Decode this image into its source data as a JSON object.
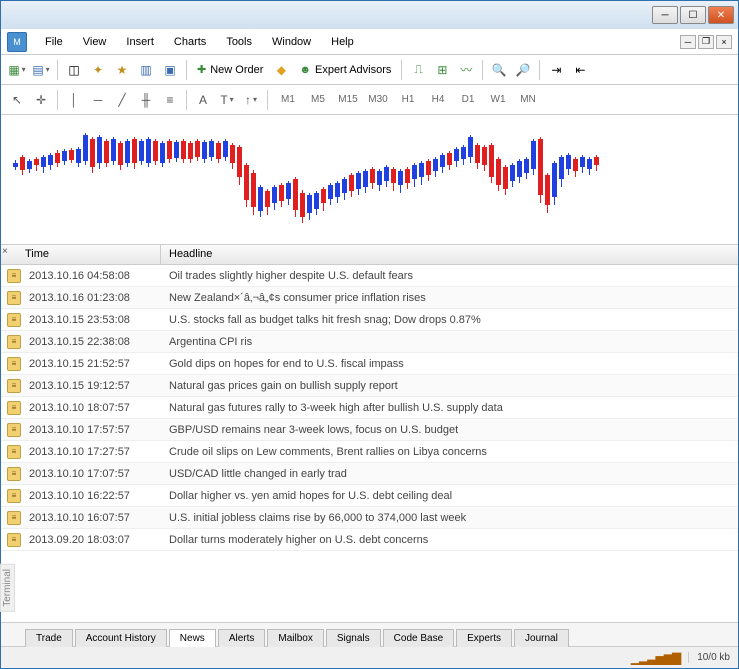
{
  "menu": {
    "items": [
      "File",
      "View",
      "Insert",
      "Charts",
      "Tools",
      "Window",
      "Help"
    ]
  },
  "toolbar": {
    "new_order": "New Order",
    "expert_advisors": "Expert Advisors"
  },
  "timeframes": [
    "M1",
    "M5",
    "M15",
    "M30",
    "H1",
    "H4",
    "D1",
    "W1",
    "MN"
  ],
  "news": {
    "columns": {
      "time": "Time",
      "headline": "Headline"
    },
    "rows": [
      {
        "time": "2013.10.16 04:58:08",
        "headline": "Oil trades slightly higher despite U.S. default fears"
      },
      {
        "time": "2013.10.16 01:23:08",
        "headline": "New Zealand×´â‚¬â„¢s consumer price inflation rises"
      },
      {
        "time": "2013.10.15 23:53:08",
        "headline": "U.S. stocks fall as budget talks hit fresh snag; Dow drops 0.87%"
      },
      {
        "time": "2013.10.15 22:38:08",
        "headline": "Argentina CPI ris"
      },
      {
        "time": "2013.10.15 21:52:57",
        "headline": "Gold dips on hopes for end to U.S. fiscal impass"
      },
      {
        "time": "2013.10.15 19:12:57",
        "headline": "Natural gas prices gain on bullish supply report"
      },
      {
        "time": "2013.10.10 18:07:57",
        "headline": "Natural gas futures rally to 3-week high after bullish U.S. supply data"
      },
      {
        "time": "2013.10.10 17:57:57",
        "headline": "GBP/USD remains near 3-week lows, focus on U.S. budget"
      },
      {
        "time": "2013.10.10 17:27:57",
        "headline": "Crude oil slips on Lew comments, Brent rallies on Libya concerns"
      },
      {
        "time": "2013.10.10 17:07:57",
        "headline": "USD/CAD little changed in early trad"
      },
      {
        "time": "2013.10.10 16:22:57",
        "headline": "Dollar higher vs. yen amid hopes for U.S. debt ceiling deal"
      },
      {
        "time": "2013.10.10 16:07:57",
        "headline": "U.S. initial jobless claims rise by 66,000 to 374,000 last week"
      },
      {
        "time": "2013.09.20 18:03:07",
        "headline": "Dollar turns moderately higher on U.S. debt concerns"
      }
    ]
  },
  "tabs": [
    "Trade",
    "Account History",
    "News",
    "Alerts",
    "Mailbox",
    "Signals",
    "Code Base",
    "Experts",
    "Journal"
  ],
  "active_tab": "News",
  "status": {
    "kb": "10/0 kb"
  },
  "terminal_label": "Terminal",
  "chart_data": {
    "type": "candlestick",
    "note": "Approximate candlestick OHLC sketch as rendered; values are pixel positions not prices",
    "candles": [
      [
        12,
        45,
        55,
        48,
        52,
        "b"
      ],
      [
        19,
        40,
        60,
        42,
        55,
        "r"
      ],
      [
        26,
        44,
        58,
        46,
        54,
        "b"
      ],
      [
        33,
        42,
        56,
        44,
        50,
        "r"
      ],
      [
        40,
        40,
        58,
        42,
        52,
        "b"
      ],
      [
        47,
        38,
        55,
        40,
        50,
        "b"
      ],
      [
        54,
        35,
        52,
        38,
        48,
        "r"
      ],
      [
        61,
        34,
        50,
        36,
        46,
        "b"
      ],
      [
        68,
        33,
        48,
        35,
        45,
        "r"
      ],
      [
        75,
        32,
        52,
        34,
        48,
        "b"
      ],
      [
        82,
        18,
        50,
        20,
        46,
        "b"
      ],
      [
        89,
        22,
        58,
        24,
        52,
        "r"
      ],
      [
        96,
        20,
        54,
        22,
        48,
        "b"
      ],
      [
        103,
        24,
        52,
        26,
        48,
        "r"
      ],
      [
        110,
        22,
        50,
        24,
        46,
        "b"
      ],
      [
        117,
        26,
        55,
        28,
        50,
        "r"
      ],
      [
        124,
        24,
        52,
        26,
        48,
        "b"
      ],
      [
        131,
        22,
        54,
        24,
        48,
        "r"
      ],
      [
        138,
        24,
        50,
        26,
        46,
        "b"
      ],
      [
        145,
        22,
        52,
        24,
        48,
        "b"
      ],
      [
        152,
        24,
        50,
        26,
        46,
        "r"
      ],
      [
        159,
        26,
        52,
        28,
        48,
        "b"
      ],
      [
        166,
        24,
        48,
        26,
        44,
        "r"
      ],
      [
        173,
        25,
        47,
        27,
        43,
        "b"
      ],
      [
        180,
        24,
        48,
        26,
        44,
        "r"
      ],
      [
        187,
        26,
        48,
        28,
        44,
        "r"
      ],
      [
        194,
        24,
        46,
        26,
        42,
        "r"
      ],
      [
        201,
        25,
        48,
        27,
        44,
        "b"
      ],
      [
        208,
        24,
        46,
        26,
        42,
        "b"
      ],
      [
        215,
        26,
        48,
        28,
        44,
        "r"
      ],
      [
        222,
        24,
        46,
        26,
        42,
        "b"
      ],
      [
        229,
        28,
        54,
        30,
        48,
        "r"
      ],
      [
        236,
        30,
        70,
        32,
        62,
        "r"
      ],
      [
        243,
        48,
        92,
        50,
        85,
        "r"
      ],
      [
        250,
        55,
        100,
        58,
        92,
        "r"
      ],
      [
        257,
        70,
        102,
        72,
        96,
        "b"
      ],
      [
        264,
        74,
        100,
        76,
        92,
        "r"
      ],
      [
        271,
        70,
        95,
        72,
        88,
        "b"
      ],
      [
        278,
        68,
        92,
        70,
        86,
        "r"
      ],
      [
        285,
        66,
        90,
        68,
        84,
        "b"
      ],
      [
        292,
        62,
        102,
        64,
        95,
        "r"
      ],
      [
        299,
        75,
        108,
        78,
        102,
        "r"
      ],
      [
        306,
        78,
        105,
        80,
        98,
        "b"
      ],
      [
        313,
        76,
        100,
        78,
        94,
        "b"
      ],
      [
        320,
        72,
        96,
        74,
        88,
        "r"
      ],
      [
        327,
        68,
        90,
        70,
        84,
        "b"
      ],
      [
        334,
        66,
        88,
        68,
        82,
        "b"
      ],
      [
        341,
        62,
        85,
        64,
        78,
        "b"
      ],
      [
        348,
        58,
        82,
        60,
        76,
        "r"
      ],
      [
        355,
        56,
        80,
        58,
        74,
        "b"
      ],
      [
        362,
        54,
        78,
        56,
        72,
        "b"
      ],
      [
        369,
        52,
        74,
        54,
        68,
        "r"
      ],
      [
        376,
        54,
        76,
        56,
        70,
        "b"
      ],
      [
        383,
        50,
        72,
        52,
        66,
        "b"
      ],
      [
        390,
        52,
        76,
        54,
        68,
        "r"
      ],
      [
        397,
        54,
        78,
        56,
        70,
        "b"
      ],
      [
        404,
        52,
        74,
        54,
        68,
        "r"
      ],
      [
        411,
        48,
        72,
        50,
        64,
        "b"
      ],
      [
        418,
        46,
        70,
        48,
        62,
        "b"
      ],
      [
        425,
        44,
        66,
        46,
        60,
        "r"
      ],
      [
        432,
        42,
        62,
        44,
        56,
        "b"
      ],
      [
        439,
        38,
        58,
        40,
        52,
        "b"
      ],
      [
        446,
        36,
        55,
        38,
        50,
        "r"
      ],
      [
        453,
        32,
        52,
        34,
        46,
        "b"
      ],
      [
        460,
        30,
        50,
        32,
        44,
        "b"
      ],
      [
        467,
        20,
        48,
        22,
        42,
        "b"
      ],
      [
        474,
        28,
        54,
        30,
        48,
        "r"
      ],
      [
        481,
        30,
        56,
        32,
        50,
        "r"
      ],
      [
        488,
        28,
        68,
        30,
        62,
        "r"
      ],
      [
        495,
        42,
        76,
        44,
        70,
        "r"
      ],
      [
        502,
        50,
        80,
        52,
        74,
        "r"
      ],
      [
        509,
        48,
        72,
        50,
        66,
        "b"
      ],
      [
        516,
        44,
        68,
        46,
        62,
        "b"
      ],
      [
        523,
        42,
        64,
        44,
        58,
        "b"
      ],
      [
        530,
        24,
        60,
        26,
        54,
        "b"
      ],
      [
        537,
        22,
        88,
        24,
        80,
        "r"
      ],
      [
        544,
        58,
        98,
        60,
        90,
        "r"
      ],
      [
        551,
        46,
        90,
        48,
        82,
        "b"
      ],
      [
        558,
        40,
        72,
        42,
        64,
        "b"
      ],
      [
        565,
        38,
        60,
        40,
        54,
        "b"
      ],
      [
        572,
        42,
        62,
        44,
        56,
        "r"
      ],
      [
        579,
        40,
        58,
        42,
        52,
        "b"
      ],
      [
        586,
        42,
        60,
        44,
        54,
        "b"
      ],
      [
        593,
        40,
        56,
        42,
        50,
        "r"
      ]
    ]
  }
}
